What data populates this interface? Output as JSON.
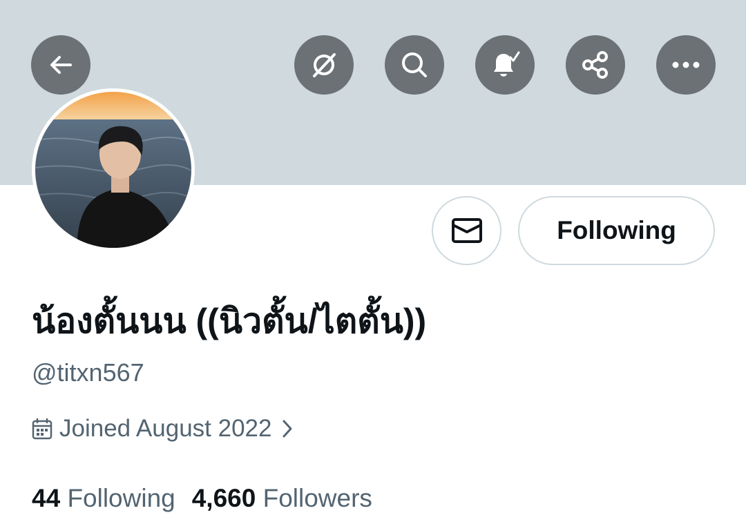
{
  "header": {
    "buttons": [
      {
        "name": "back-button",
        "icon": "arrow-left-icon"
      },
      {
        "name": "grok-button",
        "icon": "grok-icon"
      },
      {
        "name": "search-button",
        "icon": "search-icon"
      },
      {
        "name": "notifications-button",
        "icon": "bell-check-icon"
      },
      {
        "name": "share-button",
        "icon": "share-icon"
      },
      {
        "name": "more-button",
        "icon": "more-dots-icon"
      }
    ]
  },
  "profile": {
    "avatar_icon": "profile-photo",
    "display_name": "น้องตั้นนน ((นิวตั้น/ไตตั้น))",
    "handle": "@titxn567",
    "joined": "Joined August 2022",
    "message_icon": "envelope-icon",
    "follow_state": "Following",
    "stats": {
      "following_count": "44",
      "following_label": "Following",
      "followers_count": "4,660",
      "followers_label": "Followers"
    }
  },
  "colors": {
    "banner": "#cfd9de",
    "header_button_bg": "#6b7175",
    "secondary_text": "#536471",
    "primary_text": "#0f1419",
    "border": "#cfd9de"
  }
}
